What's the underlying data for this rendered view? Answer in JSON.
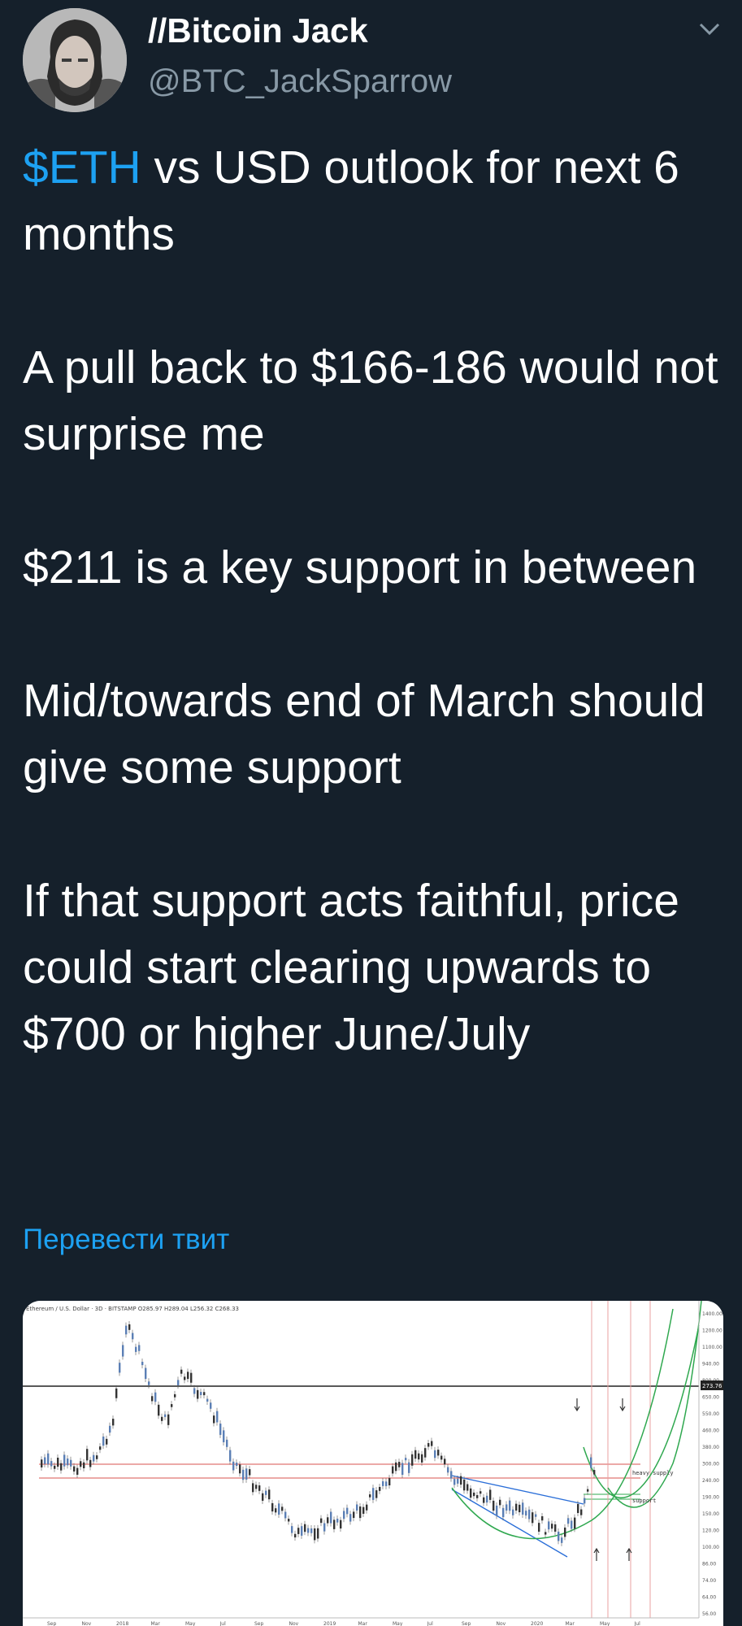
{
  "header": {
    "display_name": "//Bitcoin Jack",
    "handle": "@BTC_JackSparrow"
  },
  "tweet": {
    "cashtag": "$ETH",
    "p1_rest": " vs USD outlook for next 6 months",
    "p2": "A pull back to $166-186 would not surprise me",
    "p3": "$211 is a key support in between",
    "p4": "Mid/towards end of March should give some support",
    "p5": "If that support acts faithful, price could start clearing upwards to $700 or higher June/July"
  },
  "translate_link": "Перевести твит",
  "chart": {
    "header": "Ethereum / U.S. Dollar · 3D · BITSTAMP  O285.97  H289.04  L256.32  C268.33",
    "annotations": {
      "supply": "heavy supply",
      "support": "support"
    },
    "x_ticks": [
      "Sep",
      "Nov",
      "2018",
      "Mar",
      "May",
      "Jul",
      "Sep",
      "Nov",
      "2019",
      "Mar",
      "May",
      "Jul",
      "Sep",
      "Nov",
      "2020",
      "Mar",
      "May",
      "Jul"
    ],
    "y_ticks": [
      "1400.00",
      "1200.00",
      "1100.00",
      "940.00",
      "800.00",
      "650.00",
      "550.00",
      "460.00",
      "380.00",
      "300.00",
      "240.00",
      "190.00",
      "150.00",
      "120.00",
      "100.00",
      "86.00",
      "74.00",
      "64.00",
      "56.00"
    ],
    "price_tag": "273.76"
  },
  "colors": {
    "background": "#15202b",
    "link": "#1da1f2",
    "secondary_text": "#8899a6",
    "candle_up": "#5b7fb5",
    "candle_down": "#333333",
    "curve": "#2fa84f",
    "channel": "#2a6ed8",
    "level": "#d9534f"
  }
}
